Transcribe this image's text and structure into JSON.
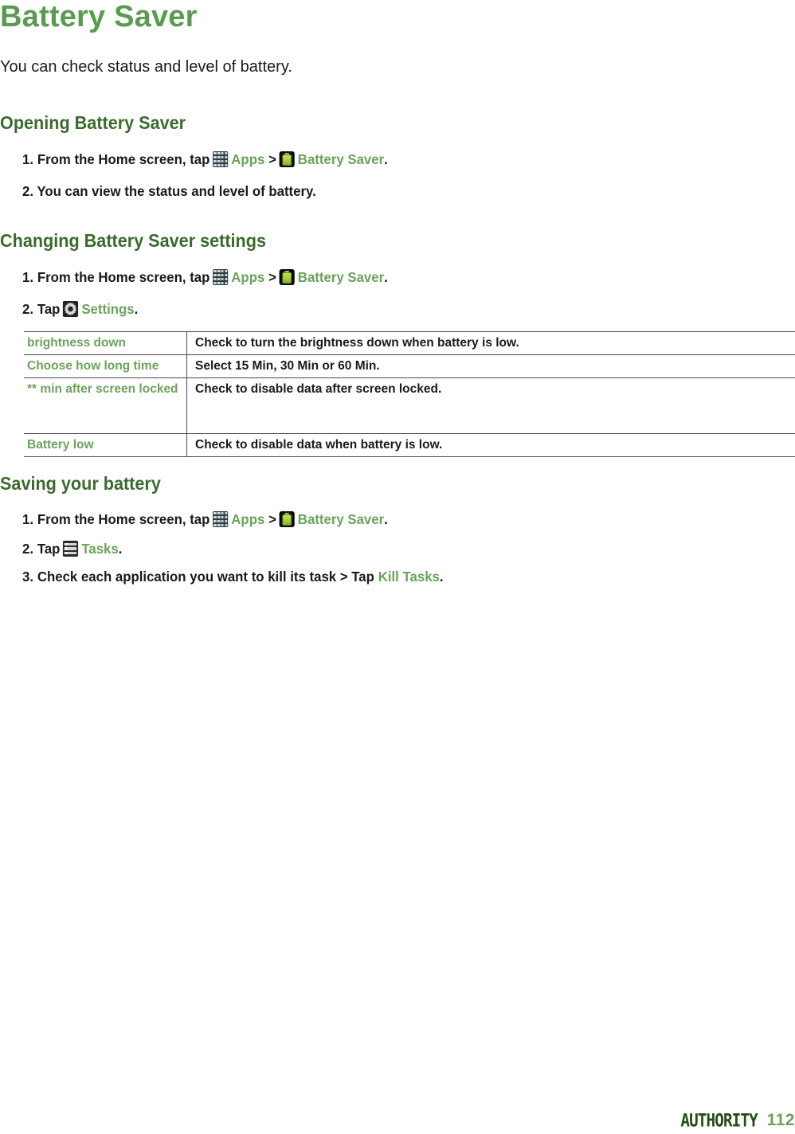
{
  "page": {
    "title": "Battery Saver",
    "intro": "You can check status and level of battery."
  },
  "sections": [
    {
      "heading": "Opening Battery Saver",
      "steps": [
        {
          "number": "1.",
          "parts": [
            {
              "type": "text",
              "value": "From the Home screen, tap"
            },
            {
              "type": "icon",
              "value": "apps-grid-icon"
            },
            {
              "type": "green",
              "value": "Apps"
            },
            {
              "type": "text",
              "value": ">"
            },
            {
              "type": "icon",
              "value": "battery-saver-icon"
            },
            {
              "type": "green",
              "value": "Battery Saver"
            },
            {
              "type": "text",
              "value": "."
            }
          ],
          "plain": "1. From the Home screen, tap Apps > Battery Saver."
        },
        {
          "number": "2.",
          "plain": "2. You can view the status and level of battery."
        }
      ]
    },
    {
      "heading": "Changing Battery Saver settings",
      "steps": [
        {
          "number": "1.",
          "plain": "1. From the Home screen, tap Apps > Battery Saver."
        },
        {
          "number": "2.",
          "plain": "2. Tap Settings."
        }
      ]
    },
    {
      "heading": "Saving your battery",
      "steps": [
        {
          "number": "1.",
          "plain": "1. From the Home screen, tap Apps > Battery Saver."
        },
        {
          "number": "2.",
          "plain": "2. Tap Tasks."
        },
        {
          "number": "3.",
          "plain": "3. Check each application you want to kill its task > Tap Kill Tasks."
        }
      ]
    }
  ],
  "step_text": {
    "from_home": "From the Home screen, tap",
    "apps": "Apps",
    "gt": ">",
    "battery_saver": "Battery Saver",
    "period": ".",
    "view_status": "2. You can view the status and level of battery.",
    "tap": "Tap",
    "settings": "Settings",
    "tasks": "Tasks",
    "check_each_app": "Check each application you want to kill its task > Tap",
    "kill_tasks": "Kill Tasks",
    "num1": "1.",
    "num2": "2.",
    "num3": "3."
  },
  "settings_table": {
    "rows": [
      {
        "label": "brightness down",
        "description": "Check to turn the brightness down when battery is low."
      },
      {
        "label": "Choose how long time",
        "description": "Select 15 Min, 30 Min or 60 Min."
      },
      {
        "label": "** min after screen locked",
        "description": "Check to disable data after screen locked."
      },
      {
        "label": "Battery low",
        "description": "Check to disable data when battery is low."
      }
    ]
  },
  "footer": {
    "brand": "AUTHORITY",
    "page_number": "112"
  },
  "colors": {
    "title_green": "#5a9c4f",
    "heading_green": "#3a6b2d",
    "accent_green": "#6aa35a",
    "body_black": "#1a1a1a",
    "rule_gray": "#4a4a4a",
    "brand_dark_green": "#254d16"
  },
  "icons": {
    "apps": "apps-grid-icon",
    "battery_saver": "battery-saver-icon",
    "settings": "settings-gear-icon",
    "tasks": "tasks-list-icon"
  }
}
